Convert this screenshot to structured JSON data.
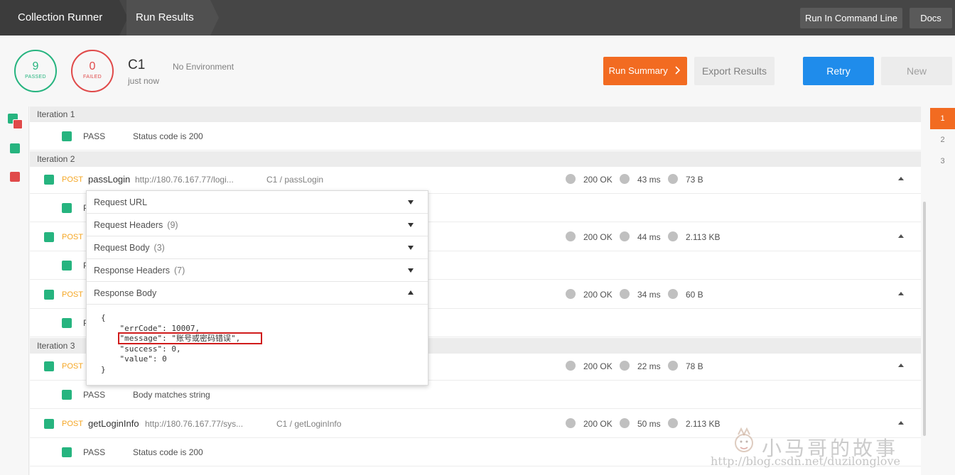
{
  "topbar": {
    "crumb1": "Collection Runner",
    "crumb2": "Run Results",
    "run_cmd_label": "Run In Command Line",
    "docs_label": "Docs"
  },
  "summary": {
    "passed_count": "9",
    "passed_label": "PASSED",
    "failed_count": "0",
    "failed_label": "FAILED",
    "collection": "C1",
    "time": "just now",
    "environment": "No Environment",
    "run_summary_label": "Run Summary",
    "export_label": "Export Results",
    "retry_label": "Retry",
    "new_label": "New"
  },
  "iterations": [
    {
      "label": "Iteration 1"
    },
    {
      "label": "Iteration 2"
    },
    {
      "label": "Iteration 3"
    }
  ],
  "rows": {
    "r1_test": {
      "status": "PASS",
      "name": "Status code is 200"
    },
    "req1": {
      "method": "POST",
      "name": "passLogin",
      "url": "http://180.76.167.77/logi...",
      "path": "C1 / passLogin",
      "status": "200 OK",
      "time": "43 ms",
      "size": "73 B"
    },
    "req2": {
      "method": "POST",
      "status": "200 OK",
      "time": "44 ms",
      "size": "2.113 KB"
    },
    "req3": {
      "method": "POST",
      "status": "200 OK",
      "time": "34 ms",
      "size": "60 B"
    },
    "req4": {
      "method": "POST",
      "status": "200 OK",
      "time": "22 ms",
      "size": "78 B"
    },
    "r4_test": {
      "status": "PASS",
      "name": "Body matches string"
    },
    "req5": {
      "method": "POST",
      "name": "getLoginInfo",
      "url": "http://180.76.167.77/sys...",
      "path": "C1 / getLoginInfo",
      "status": "200 OK",
      "time": "50 ms",
      "size": "2.113 KB"
    },
    "r5_test": {
      "status": "PASS",
      "name": "Status code is 200"
    },
    "partial_p": "P"
  },
  "popup": {
    "request_url": "Request URL",
    "request_headers": "Request Headers",
    "request_headers_count": "(9)",
    "request_body": "Request Body",
    "request_body_count": "(3)",
    "response_headers": "Response Headers",
    "response_headers_count": "(7)",
    "response_body": "Response Body",
    "code": "{\n    \"errCode\": 10007,\n    \"message\": \"账号或密码错误\",\n    \"success\": 0,\n    \"value\": 0\n}"
  },
  "pager": [
    "1",
    "2",
    "3"
  ],
  "watermark": {
    "cn": "小马哥的故事",
    "url": "http://blog.csdn.net/duzilonglove"
  },
  "colors": {
    "pass": "#26b47f",
    "fail": "#e04a4a",
    "accent": "#f26b21",
    "primary": "#1f8ceb"
  }
}
